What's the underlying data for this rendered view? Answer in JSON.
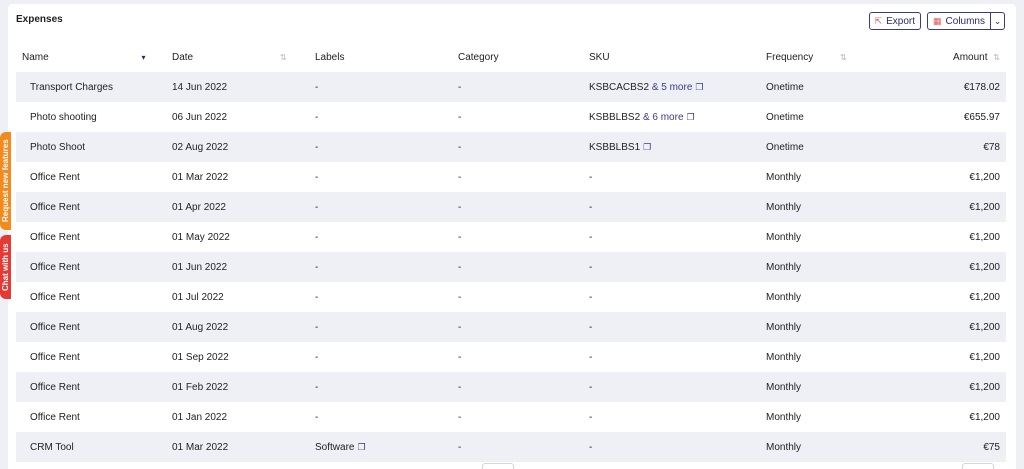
{
  "card": {
    "title": "Expenses"
  },
  "toolbar": {
    "export_label": "Export",
    "columns_label": "Columns"
  },
  "side_tabs": {
    "features": "Request new features",
    "chat": "Chat with us"
  },
  "columns": [
    "Name",
    "Date",
    "Labels",
    "Category",
    "SKU",
    "Frequency",
    "Amount"
  ],
  "rows": [
    {
      "name": "Transport Charges",
      "date": "14 Jun 2022",
      "labels": "-",
      "category": "-",
      "sku": "KSBCACBS2",
      "sku_more": "& 5 more",
      "frequency": "Onetime",
      "amount": "€178.02"
    },
    {
      "name": "Photo shooting",
      "date": "06 Jun 2022",
      "labels": "-",
      "category": "-",
      "sku": "KSBBLBS2",
      "sku_more": "& 6 more",
      "frequency": "Onetime",
      "amount": "€655.97"
    },
    {
      "name": "Photo Shoot",
      "date": "02 Aug 2022",
      "labels": "-",
      "category": "-",
      "sku": "KSBBLBS1",
      "sku_more": "",
      "frequency": "Onetime",
      "amount": "€78"
    },
    {
      "name": "Office Rent",
      "date": "01 Mar 2022",
      "labels": "-",
      "category": "-",
      "sku": "-",
      "sku_more": "",
      "frequency": "Monthly",
      "amount": "€1,200"
    },
    {
      "name": "Office Rent",
      "date": "01 Apr 2022",
      "labels": "-",
      "category": "-",
      "sku": "-",
      "sku_more": "",
      "frequency": "Monthly",
      "amount": "€1,200"
    },
    {
      "name": "Office Rent",
      "date": "01 May 2022",
      "labels": "-",
      "category": "-",
      "sku": "-",
      "sku_more": "",
      "frequency": "Monthly",
      "amount": "€1,200"
    },
    {
      "name": "Office Rent",
      "date": "01 Jun 2022",
      "labels": "-",
      "category": "-",
      "sku": "-",
      "sku_more": "",
      "frequency": "Monthly",
      "amount": "€1,200"
    },
    {
      "name": "Office Rent",
      "date": "01 Jul 2022",
      "labels": "-",
      "category": "-",
      "sku": "-",
      "sku_more": "",
      "frequency": "Monthly",
      "amount": "€1,200"
    },
    {
      "name": "Office Rent",
      "date": "01 Aug 2022",
      "labels": "-",
      "category": "-",
      "sku": "-",
      "sku_more": "",
      "frequency": "Monthly",
      "amount": "€1,200"
    },
    {
      "name": "Office Rent",
      "date": "01 Sep 2022",
      "labels": "-",
      "category": "-",
      "sku": "-",
      "sku_more": "",
      "frequency": "Monthly",
      "amount": "€1,200"
    },
    {
      "name": "Office Rent",
      "date": "01 Feb 2022",
      "labels": "-",
      "category": "-",
      "sku": "-",
      "sku_more": "",
      "frequency": "Monthly",
      "amount": "€1,200"
    },
    {
      "name": "Office Rent",
      "date": "01 Jan 2022",
      "labels": "-",
      "category": "-",
      "sku": "-",
      "sku_more": "",
      "frequency": "Monthly",
      "amount": "€1,200"
    },
    {
      "name": "CRM Tool",
      "date": "01 Mar 2022",
      "labels": "Software",
      "category": "-",
      "sku": "-",
      "sku_more": "",
      "frequency": "Monthly",
      "amount": "€75"
    }
  ]
}
